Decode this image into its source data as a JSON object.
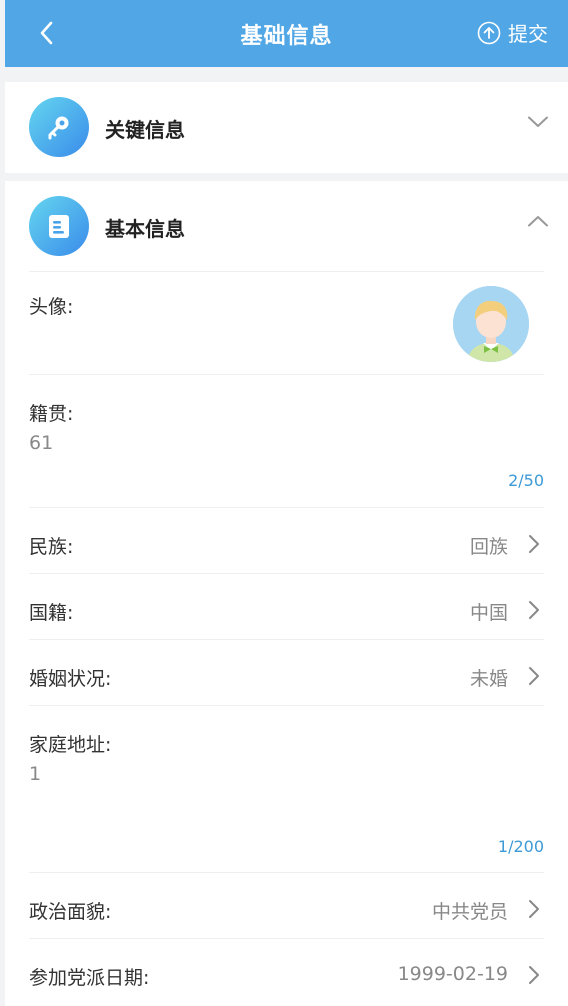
{
  "header": {
    "title": "基础信息",
    "submit_label": "提交"
  },
  "sections": {
    "key_info": {
      "title": "关键信息"
    },
    "basic_info": {
      "title": "基本信息"
    }
  },
  "fields": {
    "avatar": {
      "label": "头像:"
    },
    "native_place": {
      "label": "籍贯:",
      "value": "61",
      "counter": "2/50"
    },
    "ethnicity": {
      "label": "民族:",
      "value": "回族"
    },
    "nationality": {
      "label": "国籍:",
      "value": "中国"
    },
    "marital_status": {
      "label": "婚姻状况:",
      "value": "未婚"
    },
    "home_address": {
      "label": "家庭地址:",
      "value": "1",
      "counter": "1/200"
    },
    "political_status": {
      "label": "政治面貌:",
      "value": "中共党员"
    },
    "party_join_date": {
      "label": "参加党派日期:",
      "value": "1999-02-19"
    }
  },
  "colors": {
    "header_bg": "#51a7e5",
    "accent": "#3d9ad6"
  }
}
